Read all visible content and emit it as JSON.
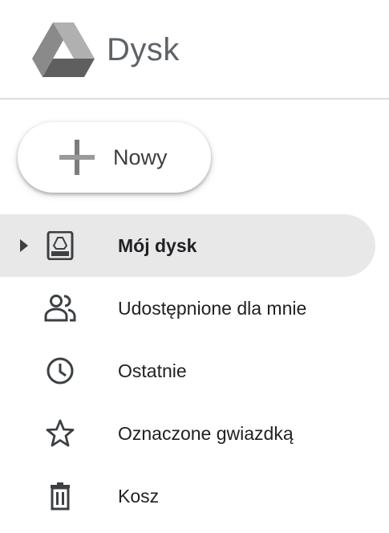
{
  "header": {
    "app_name": "Dysk",
    "logo_icon": "google-drive-logo-icon"
  },
  "new_button": {
    "label": "Nowy",
    "icon": "plus-icon"
  },
  "nav": {
    "items": [
      {
        "label": "Mój dysk",
        "icon": "my-drive-icon",
        "active": true,
        "expandable": true
      },
      {
        "label": "Udostępnione dla mnie",
        "icon": "shared-people-icon",
        "active": false
      },
      {
        "label": "Ostatnie",
        "icon": "clock-icon",
        "active": false
      },
      {
        "label": "Oznaczone gwiazdką",
        "icon": "star-icon",
        "active": false
      },
      {
        "label": "Kosz",
        "icon": "trash-icon",
        "active": false
      }
    ]
  },
  "colors": {
    "active_background": "#e8e8e8",
    "icon_color": "#3c4043",
    "divider": "#dcdcdc"
  }
}
